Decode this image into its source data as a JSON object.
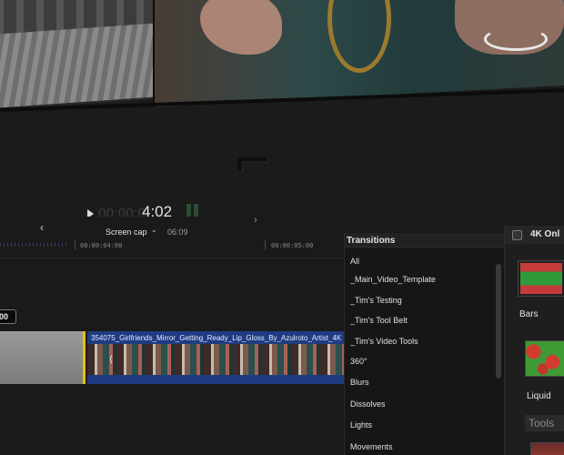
{
  "viewer": {
    "timecode_dim": "00:00:0",
    "timecode_bright": "4:02"
  },
  "toolbar": {
    "project_name": "Screen cap",
    "duration": "06:09"
  },
  "timeline": {
    "ruler_labels": [
      "00:00:04:00",
      "00:00:05:00"
    ],
    "time_badge": "00",
    "clip_title": "354075_Girlfriends_Mirror_Getting_Ready_Lip_Gloss_By_Azulroto_Artist_4K"
  },
  "transitions": {
    "title": "Transitions",
    "items": [
      "All",
      "_Main_Video_Template",
      "_Tim's Testing",
      "_Tim's Tool Belt",
      "_Tim's Video Tools",
      "360°",
      "Blurs",
      "Dissolves",
      "Lights",
      "Movements"
    ]
  },
  "browser": {
    "title": "4K Onl",
    "effects": [
      "Bars",
      "Liquid"
    ],
    "section": "Tools"
  },
  "colors": {
    "clip_blue": "#1f3c82",
    "selection_yellow": "#e6c200",
    "meter_green": "#2e4a31"
  }
}
